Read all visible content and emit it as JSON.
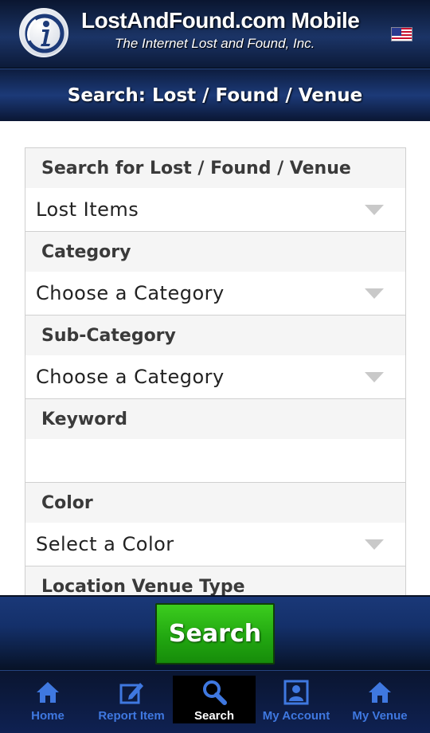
{
  "header": {
    "brand_title": "LostAndFound.com Mobile",
    "brand_subtitle": "The Internet Lost and Found, Inc.",
    "logo_icon": "info-logo-icon",
    "flag_icon": "us-flag-icon"
  },
  "page_title": "Search: Lost / Found / Venue",
  "form": {
    "search_type": {
      "label": "Search for Lost / Found / Venue",
      "value": "Lost Items"
    },
    "category": {
      "label": "Category",
      "value": "Choose a Category"
    },
    "sub_category": {
      "label": "Sub-Category",
      "value": "Choose a Category"
    },
    "keyword": {
      "label": "Keyword",
      "value": ""
    },
    "color": {
      "label": "Color",
      "value": "Select a Color"
    },
    "location_venue_type": {
      "label": "Location Venue Type"
    }
  },
  "search_button": {
    "label": "Search"
  },
  "tabs": [
    {
      "label": "Home",
      "icon": "home-icon",
      "active": false
    },
    {
      "label": "Report Item",
      "icon": "edit-icon",
      "active": false
    },
    {
      "label": "Search",
      "icon": "search-icon",
      "active": true
    },
    {
      "label": "My Account",
      "icon": "account-icon",
      "active": false
    },
    {
      "label": "My Venue",
      "icon": "venue-home-icon",
      "active": false
    }
  ],
  "colors": {
    "header_bg": "#1b3466",
    "search_button": "#22a811",
    "tab_label": "#3f78e0",
    "active_tab_bg": "#000000"
  }
}
